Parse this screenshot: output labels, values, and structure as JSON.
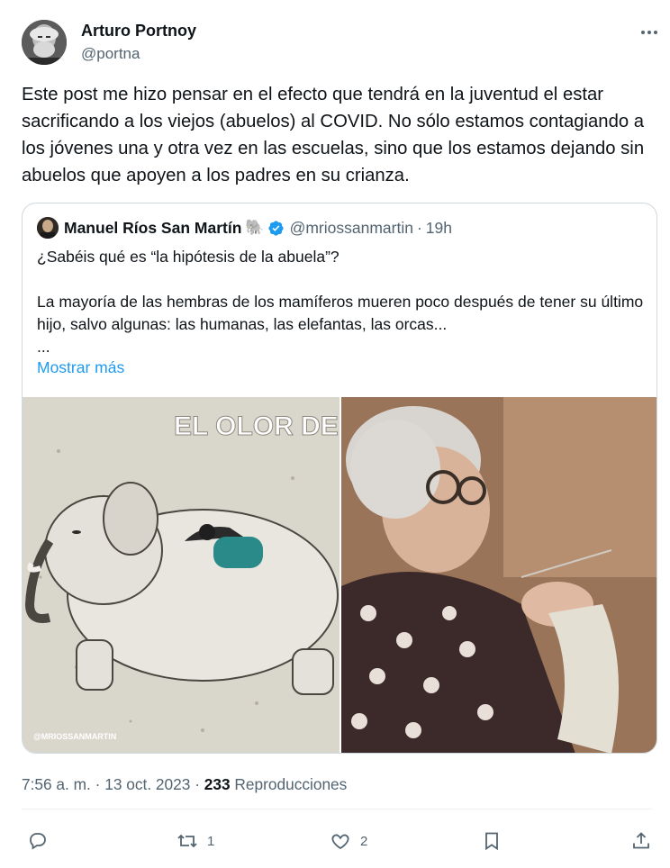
{
  "author": {
    "name": "Arturo Portnoy",
    "handle": "@portna"
  },
  "tweet": {
    "text": "Este post me hizo pensar en el efecto que tendrá en la juventud el estar sacrificando a los viejos (abuelos) al COVID. No sólo estamos contagiando a los jóvenes una y otra vez en las escuelas, sino que los estamos dejando sin abuelos que apoyen a los padres en su crianza."
  },
  "quote": {
    "name": "Manuel Ríos San Martín",
    "emoji": "🐘",
    "handle": "@mriossanmartin",
    "separator": "·",
    "time": "19h",
    "text": "¿Sabéis qué es “la hipótesis de la abuela”?\n\nLa mayoría de las hembras de los mamíferos mueren poco después de tener su último hijo, salvo algunas: las humanas, las elefantas, las orcas...\n...",
    "show_more": "Mostrar más",
    "image_left": {
      "banner": "EL OLOR DEL",
      "credit": "@MRIOSSANMARTIN"
    }
  },
  "meta": {
    "time": "7:56 a. m.",
    "sep1": "·",
    "date": "13 oct. 2023",
    "sep2": "·",
    "views": "233",
    "views_label": "Reproducciones"
  },
  "actions": {
    "reply_count": "",
    "retweet_count": "1",
    "like_count": "2"
  },
  "icons": [
    "more-icon",
    "verified-badge-icon",
    "reply-icon",
    "retweet-icon",
    "like-icon",
    "bookmark-icon",
    "share-icon"
  ],
  "colors": {
    "accent": "#1d9bf0",
    "text": "#0f1419",
    "secondary": "#536471",
    "border": "#cfd9de"
  }
}
